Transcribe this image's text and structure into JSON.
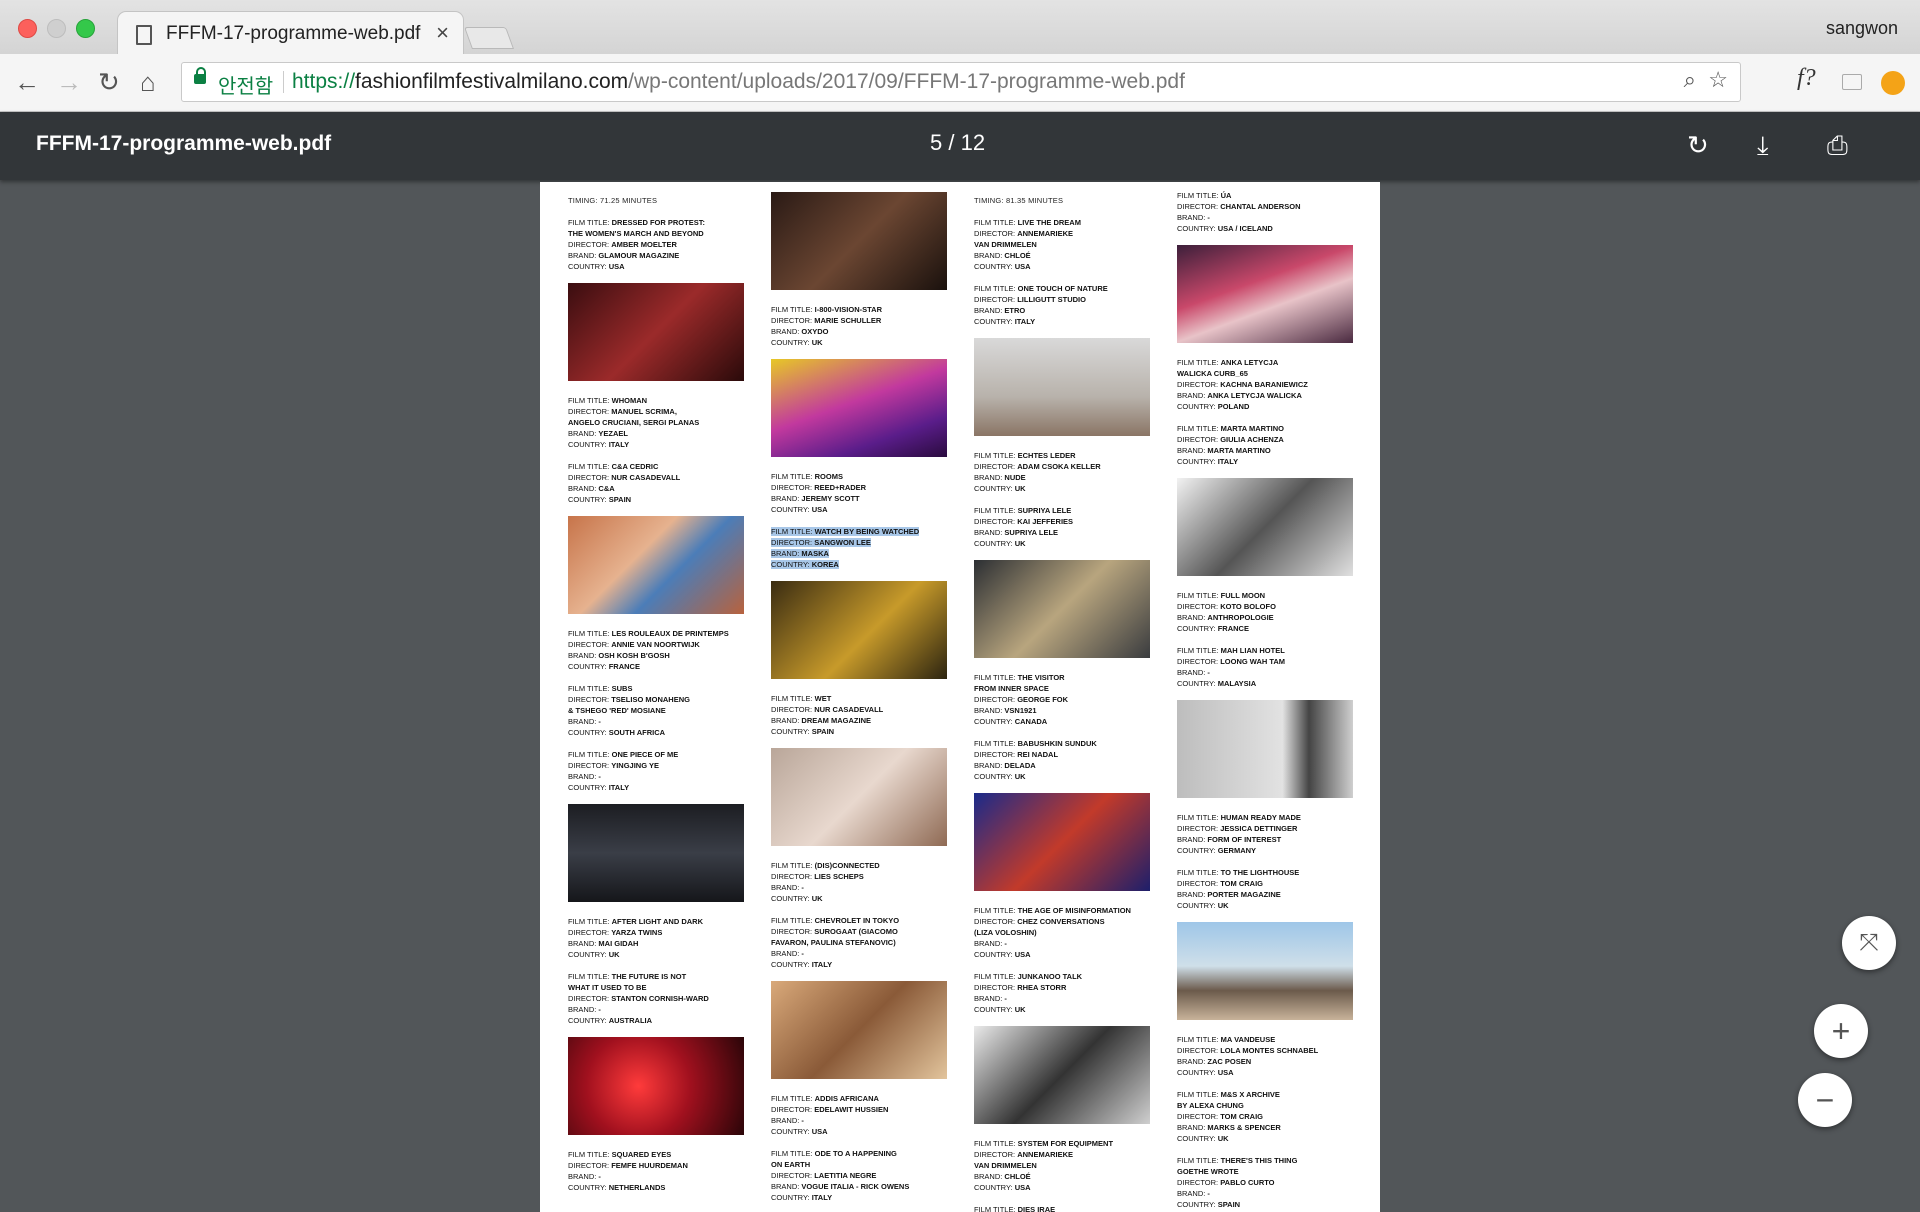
{
  "browser": {
    "tab_title": "FFFM-17-programme-web.pdf",
    "tab_close": "×",
    "user": "sangwon",
    "secure_label": "안전함",
    "url_scheme": "https://",
    "url_host": "fashionfilmfestivalmilano.com",
    "url_path": "/wp-content/uploads/2017/09/FFFM-17-programme-web.pdf",
    "ext_label": "f?"
  },
  "viewer": {
    "title": "FFFM-17-programme-web.pdf",
    "page_current": "5",
    "page_sep": "/",
    "page_total": "12"
  },
  "page": {
    "columns": [
      {
        "timing": "TIMING: 71.25 MINUTES",
        "items": [
          {
            "type": "entry",
            "lines": [
              "FILM TITLE: DRESSED FOR PROTEST:",
              "THE WOMEN'S MARCH AND BEYOND",
              "DIRECTOR: AMBER MOELTER",
              "BRAND: GLAMOUR MAGAZINE",
              "COUNTRY: USA"
            ]
          },
          {
            "type": "photo",
            "bg": "linear-gradient(135deg,#3a0d10,#9b2a2a 50%,#2a0a0a)"
          },
          {
            "type": "entry",
            "lines": [
              "FILM TITLE: WHOMAN",
              "DIRECTOR: MANUEL SCRIMA,",
              "ANGELO CRUCIANI, SERGI PLANAS",
              "BRAND: YEZAEL",
              "COUNTRY: ITALY"
            ]
          },
          {
            "type": "entry",
            "lines": [
              "FILM TITLE: C&A CEDRIC",
              "DIRECTOR: NUR CASADEVALL",
              "BRAND: C&A",
              "COUNTRY: SPAIN"
            ]
          },
          {
            "type": "photo",
            "bg": "linear-gradient(135deg,#c7744a,#e6b28f 40%,#4b7db8 60%,#b8623d)"
          },
          {
            "type": "entry",
            "lines": [
              "FILM TITLE: LES ROULEAUX DE PRINTEMPS",
              "DIRECTOR: ANNIE VAN NOORTWIJK",
              "BRAND: OSH KOSH B'GOSH",
              "COUNTRY: FRANCE"
            ]
          },
          {
            "type": "entry",
            "lines": [
              "FILM TITLE: SUBS",
              "DIRECTOR: TSELISO MONAHENG",
              "& TSHEGO 'RED' MOSIANE",
              "BRAND: -",
              "COUNTRY: SOUTH AFRICA"
            ]
          },
          {
            "type": "entry",
            "lines": [
              "FILM TITLE: ONE PIECE OF ME",
              "DIRECTOR: YINGJING YE",
              "BRAND: -",
              "COUNTRY: ITALY"
            ]
          },
          {
            "type": "photo",
            "bg": "linear-gradient(180deg,#1c1d22,#3a3e47 50%,#15161a)"
          },
          {
            "type": "entry",
            "lines": [
              "FILM TITLE: AFTER LIGHT AND DARK",
              "DIRECTOR: YARZA TWINS",
              "BRAND: MAI GIDAH",
              "COUNTRY: UK"
            ]
          },
          {
            "type": "entry",
            "lines": [
              "FILM TITLE: THE FUTURE IS NOT",
              "WHAT IT USED TO BE",
              "DIRECTOR: STANTON CORNISH-WARD",
              "BRAND: -",
              "COUNTRY: AUSTRALIA"
            ]
          },
          {
            "type": "photo",
            "bg": "radial-gradient(circle at 40% 50%,#ff3b3b,#a0101e 45%,#2a0508)"
          },
          {
            "type": "entry",
            "lines": [
              "FILM TITLE: SQUARED EYES",
              "DIRECTOR: FEMFE HUURDEMAN",
              "BRAND: -",
              "COUNTRY: NETHERLANDS"
            ]
          }
        ]
      },
      {
        "timing": "",
        "items": [
          {
            "type": "photo",
            "bg": "linear-gradient(135deg,#2a1a15,#6b4632 50%,#1a110d)"
          },
          {
            "type": "entry",
            "lines": [
              "FILM TITLE: I-800-VISION-STAR",
              "DIRECTOR: MARIE SCHULLER",
              "BRAND: OXYDO",
              "COUNTRY: UK"
            ]
          },
          {
            "type": "photo",
            "bg": "linear-gradient(160deg,#e7c826,#c2399e 45%,#5a1d8a 75%,#2a0b3e)"
          },
          {
            "type": "entry",
            "lines": [
              "FILM TITLE: ROOMS",
              "DIRECTOR: REED+RADER",
              "BRAND: JEREMY SCOTT",
              "COUNTRY: USA"
            ]
          },
          {
            "type": "entry",
            "highlight": true,
            "lines": [
              "FILM TITLE: WATCH BY BEING WATCHED",
              "DIRECTOR: SANGWON LEE",
              "BRAND: MASKA",
              "COUNTRY: KOREA"
            ]
          },
          {
            "type": "photo",
            "bg": "linear-gradient(135deg,#3a2c12,#c79a2a 55%,#2c2410)"
          },
          {
            "type": "entry",
            "lines": [
              "FILM TITLE: WET",
              "DIRECTOR: NUR CASADEVALL",
              "BRAND: DREAM MAGAZINE",
              "COUNTRY: SPAIN"
            ]
          },
          {
            "type": "photo",
            "bg": "linear-gradient(135deg,#b9a699,#e8d8ce 50%,#8f6a54)"
          },
          {
            "type": "entry",
            "lines": [
              "FILM TITLE: (DIS)CONNECTED",
              "DIRECTOR: LIES SCHEPS",
              "BRAND: -",
              "COUNTRY: UK"
            ]
          },
          {
            "type": "entry",
            "lines": [
              "FILM TITLE: CHEVROLET IN TOKYO",
              "DIRECTOR: SUROGAAT (GIACOMO",
              "FAVARON, PAULINA STEFANOVIC)",
              "BRAND: -",
              "COUNTRY: ITALY"
            ]
          },
          {
            "type": "photo",
            "bg": "linear-gradient(135deg,#d9a97a,#8a5a38 50%,#e2c49c)"
          },
          {
            "type": "entry",
            "lines": [
              "FILM TITLE: ADDIS AFRICANA",
              "DIRECTOR: EDELAWIT HUSSIEN",
              "BRAND: -",
              "COUNTRY: USA"
            ]
          },
          {
            "type": "entry",
            "lines": [
              "FILM TITLE: ODE TO A HAPPENING",
              "ON EARTH",
              "DIRECTOR: LAETITIA NEGRE",
              "BRAND: VOGUE ITALIA - RICK OWENS",
              "COUNTRY: ITALY"
            ]
          }
        ]
      },
      {
        "timing": "TIMING: 81.35 MINUTES",
        "items": [
          {
            "type": "entry",
            "lines": [
              "FILM TITLE: LIVE THE DREAM",
              "DIRECTOR: ANNEMARIEKE",
              "VAN DRIMMELEN",
              "BRAND: CHLOÉ",
              "COUNTRY: USA"
            ]
          },
          {
            "type": "entry",
            "lines": [
              "FILM TITLE: ONE TOUCH OF NATURE",
              "DIRECTOR: LILLIGUTT STUDIO",
              "BRAND: ETRO",
              "COUNTRY: ITALY"
            ]
          },
          {
            "type": "photo",
            "bg": "linear-gradient(180deg,#d9d9d9,#b8b2ab 60%,#8a7565)"
          },
          {
            "type": "entry",
            "lines": [
              "FILM TITLE: ECHTES LEDER",
              "DIRECTOR: ADAM CSOKA KELLER",
              "BRAND: NUDE",
              "COUNTRY: UK"
            ]
          },
          {
            "type": "entry",
            "lines": [
              "FILM TITLE: SUPRIYA LELE",
              "DIRECTOR: KAI JEFFERIES",
              "BRAND: SUPRIYA LELE",
              "COUNTRY: UK"
            ]
          },
          {
            "type": "photo",
            "bg": "linear-gradient(135deg,#2c2f33,#b8a57e 50%,#3a3c3f)"
          },
          {
            "type": "entry",
            "lines": [
              "FILM TITLE: THE VISITOR",
              "FROM INNER SPACE",
              "DIRECTOR: GEORGE FOK",
              "BRAND: VSN1921",
              "COUNTRY: CANADA"
            ]
          },
          {
            "type": "entry",
            "lines": [
              "FILM TITLE: BABUSHKIN SUNDUK",
              "DIRECTOR: REI NADAL",
              "BRAND: DELADA",
              "COUNTRY: UK"
            ]
          },
          {
            "type": "photo",
            "bg": "linear-gradient(135deg,#1a2a8a,#c23a2a 50%,#1d1f6b)"
          },
          {
            "type": "entry",
            "lines": [
              "FILM TITLE: THE AGE OF MISINFORMATION",
              "DIRECTOR: CHEZ CONVERSATIONS",
              "(LIZA VOLOSHIN)",
              "BRAND: -",
              "COUNTRY: USA"
            ]
          },
          {
            "type": "entry",
            "lines": [
              "FILM TITLE: JUNKANOO TALK",
              "DIRECTOR: RHEA STORR",
              "BRAND: -",
              "COUNTRY: UK"
            ]
          },
          {
            "type": "photo",
            "bg": "linear-gradient(135deg,#eaeaea,#333 50%,#cfcfcf)"
          },
          {
            "type": "entry",
            "lines": [
              "FILM TITLE: SYSTEM FOR EQUIPMENT",
              "DIRECTOR: ANNEMARIEKE",
              "VAN DRIMMELEN",
              "BRAND: CHLOÉ",
              "COUNTRY: USA"
            ]
          },
          {
            "type": "entry",
            "lines": [
              "FILM TITLE: DIES IRAE"
            ]
          }
        ]
      },
      {
        "timing": "",
        "items": [
          {
            "type": "entry",
            "lines": [
              "FILM TITLE: ÚA",
              "DIRECTOR: CHANTAL ANDERSON",
              "BRAND: -",
              "COUNTRY: USA / ICELAND"
            ]
          },
          {
            "type": "photo",
            "bg": "linear-gradient(160deg,#3c1f3a,#c9486a 40%,#e8c3c8 60%,#4a2a40)"
          },
          {
            "type": "entry",
            "lines": [
              "FILM TITLE: ANKA LETYCJA",
              "WALICKA CURB_65",
              "DIRECTOR: KACHNA BARANIEWICZ",
              "BRAND: ANKA LETYCJA WALICKA",
              "COUNTRY: POLAND"
            ]
          },
          {
            "type": "entry",
            "lines": [
              "FILM TITLE: MARTA MARTINO",
              "DIRECTOR: GIULIA ACHENZA",
              "BRAND: MARTA MARTINO",
              "COUNTRY: ITALY"
            ]
          },
          {
            "type": "photo",
            "bg": "linear-gradient(135deg,#f2f2f2,#555 50%,#e0e0e0)"
          },
          {
            "type": "entry",
            "lines": [
              "FILM TITLE: FULL MOON",
              "DIRECTOR: KOTO BOLOFO",
              "BRAND: ANTHROPOLOGIE",
              "COUNTRY: FRANCE"
            ]
          },
          {
            "type": "entry",
            "lines": [
              "FILM TITLE: MAH LIAN HOTEL",
              "DIRECTOR: LOONG WAH TAM",
              "BRAND: -",
              "COUNTRY: MALAYSIA"
            ]
          },
          {
            "type": "photo",
            "bg": "linear-gradient(90deg,#bdbdbd,#e2e2e2 60%,#444 75%,#cfcfcf)"
          },
          {
            "type": "entry",
            "lines": [
              "FILM TITLE: HUMAN READY MADE",
              "DIRECTOR: JESSICA DETTINGER",
              "BRAND: FORM OF INTEREST",
              "COUNTRY: GERMANY"
            ]
          },
          {
            "type": "entry",
            "lines": [
              "FILM TITLE: TO THE LIGHTHOUSE",
              "DIRECTOR: TOM CRAIG",
              "BRAND: PORTER MAGAZINE",
              "COUNTRY: UK"
            ]
          },
          {
            "type": "photo",
            "bg": "linear-gradient(180deg,#9ec6e8,#cfdfe9 45%,#6b5a4b 70%,#c8b39a)"
          },
          {
            "type": "entry",
            "lines": [
              "FILM TITLE: MA VANDEUSE",
              "DIRECTOR: LOLA MONTES SCHNABEL",
              "BRAND: ZAC POSEN",
              "COUNTRY: USA"
            ]
          },
          {
            "type": "entry",
            "lines": [
              "FILM TITLE: M&S X ARCHIVE",
              "BY ALEXA CHUNG",
              "DIRECTOR: TOM CRAIG",
              "BRAND: MARKS & SPENCER",
              "COUNTRY: UK"
            ]
          },
          {
            "type": "entry",
            "lines": [
              "FILM TITLE: THERE'S THIS THING",
              "GOETHE WROTE",
              "DIRECTOR: PABLO CURTO",
              "BRAND: -",
              "COUNTRY: SPAIN"
            ]
          }
        ]
      }
    ]
  },
  "icons": {
    "back": "←",
    "forward": "→",
    "reload": "↻",
    "home": "⌂",
    "zoom": "⌕",
    "star": "☆",
    "rotate": "↻",
    "download": "⤓",
    "print": "⎙",
    "fit": "⤧",
    "zoom_in": "+",
    "zoom_out": "−"
  }
}
